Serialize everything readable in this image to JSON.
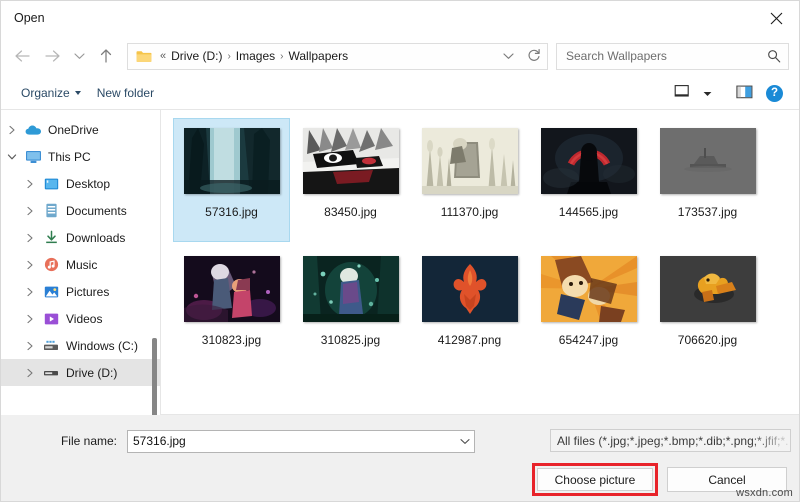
{
  "window": {
    "title": "Open",
    "close_icon": "close-icon"
  },
  "navigation": {
    "back_icon": "arrow-left-icon",
    "forward_icon": "arrow-right-icon",
    "recent_icon": "chevron-down-icon",
    "up_icon": "arrow-up-icon",
    "folder_icon": "folder-icon",
    "overflow_chevrons": "«",
    "breadcrumbs": [
      "Drive (D:)",
      "Images",
      "Wallpapers"
    ],
    "separator": "›",
    "address_dropdown_icon": "chevron-down-icon",
    "refresh_icon": "refresh-icon"
  },
  "search": {
    "placeholder": "Search Wallpapers",
    "value": "",
    "icon": "search-icon"
  },
  "toolbar": {
    "organize_label": "Organize",
    "new_folder_label": "New folder",
    "view_icon": "view-layout-icon",
    "view_dropdown_icon": "caret-down-icon",
    "preview_pane_icon": "preview-pane-icon",
    "help_label": "?",
    "help_icon": "help-icon"
  },
  "sidebar": {
    "items": [
      {
        "label": "OneDrive",
        "icon": "cloud-icon",
        "indent": 1,
        "expander": "chevron-right",
        "selected": false
      },
      {
        "label": "This PC",
        "icon": "monitor-icon",
        "indent": 1,
        "expander": "chevron-down",
        "selected": false
      },
      {
        "label": "Desktop",
        "icon": "desktop-icon",
        "indent": 2,
        "expander": "chevron-right",
        "selected": false
      },
      {
        "label": "Documents",
        "icon": "documents-icon",
        "indent": 2,
        "expander": "chevron-right",
        "selected": false
      },
      {
        "label": "Downloads",
        "icon": "downloads-icon",
        "indent": 2,
        "expander": "chevron-right",
        "selected": false
      },
      {
        "label": "Music",
        "icon": "music-icon",
        "indent": 2,
        "expander": "chevron-right",
        "selected": false
      },
      {
        "label": "Pictures",
        "icon": "pictures-icon",
        "indent": 2,
        "expander": "chevron-right",
        "selected": false
      },
      {
        "label": "Videos",
        "icon": "videos-icon",
        "indent": 2,
        "expander": "chevron-right",
        "selected": false
      },
      {
        "label": "Windows (C:)",
        "icon": "drive-icon",
        "indent": 2,
        "expander": "chevron-right",
        "selected": false
      },
      {
        "label": "Drive (D:)",
        "icon": "drive-icon",
        "indent": 2,
        "expander": "chevron-right",
        "selected": true
      }
    ]
  },
  "files": [
    {
      "name": "57316.jpg",
      "selected": true,
      "thumb": "forest-waterfall"
    },
    {
      "name": "83450.jpg",
      "selected": false,
      "thumb": "anime-white-hair"
    },
    {
      "name": "111370.jpg",
      "selected": false,
      "thumb": "sepia-grass-figure"
    },
    {
      "name": "144565.jpg",
      "selected": false,
      "thumb": "dark-red-moon-cloak"
    },
    {
      "name": "173537.jpg",
      "selected": false,
      "thumb": "gray-minimal-ship"
    },
    {
      "name": "310823.jpg",
      "selected": false,
      "thumb": "anime-couple-pink"
    },
    {
      "name": "310825.jpg",
      "selected": false,
      "thumb": "anime-teal-forest"
    },
    {
      "name": "412987.png",
      "selected": false,
      "thumb": "skyrim-dragon-emblem"
    },
    {
      "name": "654247.jpg",
      "selected": false,
      "thumb": "orange-comic-action"
    },
    {
      "name": "706620.jpg",
      "selected": false,
      "thumb": "gray-orange-creature"
    }
  ],
  "footer": {
    "file_name_label": "File name:",
    "file_name_value": "57316.jpg",
    "file_name_dropdown_icon": "chevron-down-icon",
    "filter_value": "All files (*.jpg;*.jpeg;*.bmp;*.dib;*.png;*.jfif;*.",
    "choose_button": "Choose picture",
    "cancel_button": "Cancel"
  },
  "watermark": "wsxdn.com",
  "colors": {
    "accent_blue": "#1a8ad6",
    "selection_blue": "#cde8f7",
    "annotation_red": "#e8232a",
    "footer_gray": "#f0f0f0"
  }
}
